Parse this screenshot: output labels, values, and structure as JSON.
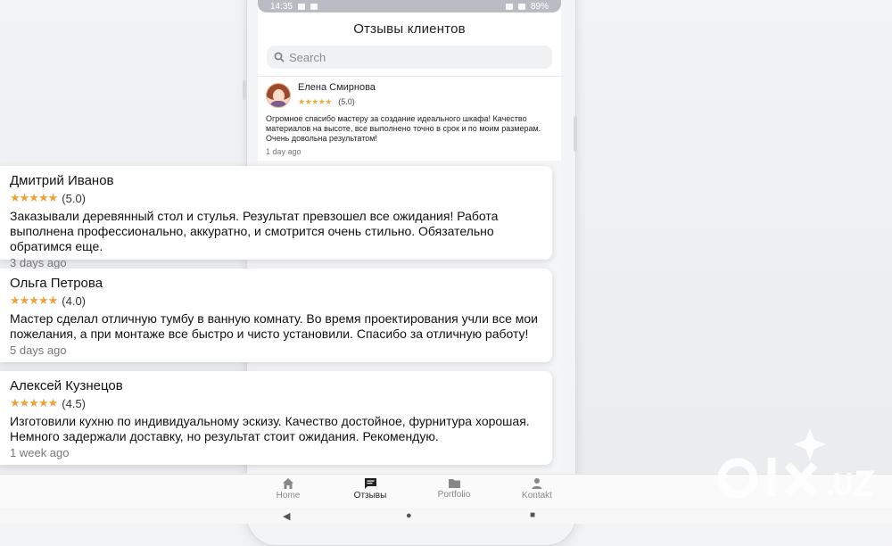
{
  "status": {
    "time": "14:35",
    "battery": "89%"
  },
  "app": {
    "title": "Отзывы клиентов",
    "search_placeholder": "Search"
  },
  "inner_review": {
    "name": "Елена Смирнова",
    "stars": "★★★★★",
    "score": "(5.0)",
    "text": "Огромное спасибо мастеру за создание идеального шкафа! Качество материалов на высоте, все выполнено точно в срок и по моим размерам. Очень довольна результатом!",
    "time": "1 day ago"
  },
  "reviews": [
    {
      "name": "Дмитрий Иванов",
      "stars": "★★★★★",
      "score": "(5.0)",
      "text": "Заказывали деревянный стол и стулья. Результат превзошел все ожидания! Работа выполнена профессионально, аккуратно, и смотрится очень стильно. Обязательно обратимся еще.",
      "time": "3 days ago"
    },
    {
      "name": "Ольга Петрова",
      "stars": "★★★★★",
      "score": "(4.0)",
      "text": "Мастер сделал отличную тумбу в ванную комнату. Во время проектирования учли все мои пожелания, а при монтаже все быстро и чисто установили. Спасибо за отличную работу!",
      "time": "5 days ago"
    },
    {
      "name": "Алексей Кузнецов",
      "stars": "★★★★★",
      "score": "(4.5)",
      "text": "Изготовили кухню по индивидуальному эскизу. Качество достойное, фурнитура хорошая. Немного задержали доставку, но результат стоит ожидания. Рекомендую.",
      "time": "1 week ago"
    }
  ],
  "nav": [
    {
      "label": "Home",
      "icon": "home-icon"
    },
    {
      "label": "Отзывы",
      "icon": "chat-icon"
    },
    {
      "label": "Portfolio",
      "icon": "folder-icon"
    },
    {
      "label": "Kontakt",
      "icon": "person-icon"
    }
  ],
  "system_nav": {
    "back": "◀",
    "home": "●",
    "recent": "■"
  },
  "watermark": "olx.uz",
  "colors": {
    "star": "#f0a23a",
    "active_nav": "#222222",
    "inactive_nav": "#888888"
  }
}
